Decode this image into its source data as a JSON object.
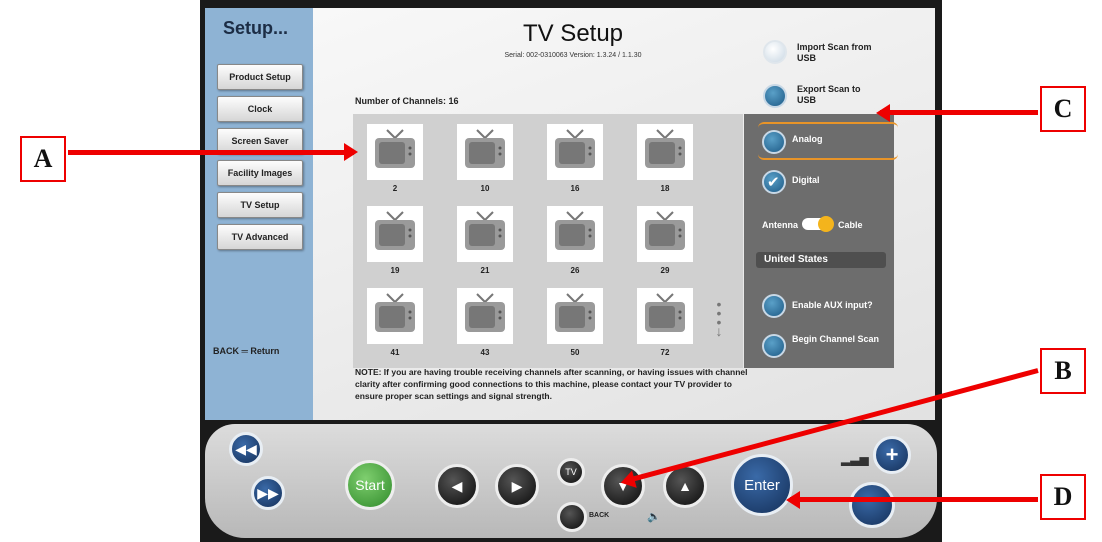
{
  "sidebar": {
    "title": "Setup...",
    "items": [
      "Product Setup",
      "Clock",
      "Screen Saver",
      "Facility Images",
      "TV Setup",
      "TV Advanced"
    ],
    "back": "BACK ═ Return"
  },
  "header": {
    "title": "TV Setup",
    "serial": "Serial: 002-0310063   Version: 1.3.24 / 1.1.30"
  },
  "channels": {
    "label": "Number of Channels: 16",
    "list": [
      "2",
      "10",
      "16",
      "18",
      "19",
      "21",
      "26",
      "29",
      "41",
      "43",
      "50",
      "72"
    ]
  },
  "note": "NOTE: If you are having trouble receiving channels after scanning, or having issues with channel clarity after confirming good connections to this machine, please contact your TV provider to ensure proper scan settings and signal strength.",
  "actions": {
    "import": "Import Scan from USB",
    "export": "Export Scan to USB"
  },
  "options": {
    "analog": "Analog",
    "digital": "Digital",
    "antenna": "Antenna",
    "cable": "Cable",
    "country": "United States",
    "aux": "Enable AUX input?",
    "scan": "Begin Channel Scan"
  },
  "controls": {
    "start": "Start",
    "enter": "Enter",
    "back": "BACK"
  },
  "callouts": {
    "a": "A",
    "b": "B",
    "c": "C",
    "d": "D"
  },
  "colors": {
    "accent": "#e89428",
    "callout": "#e00000",
    "sidebar": "#8eb3d4"
  }
}
